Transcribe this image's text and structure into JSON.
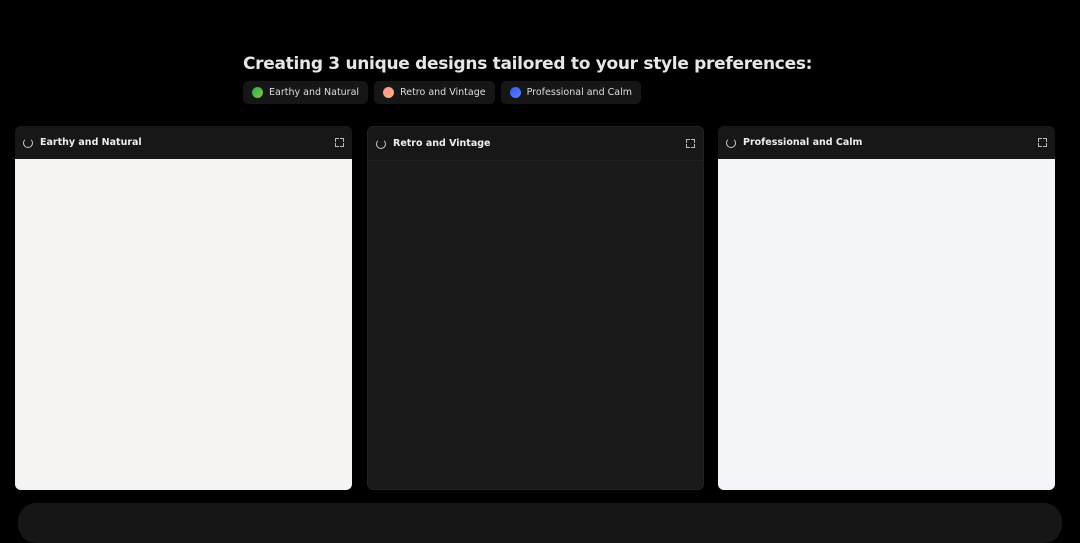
{
  "heading": "Creating 3 unique designs tailored to your style preferences:",
  "chips": [
    {
      "label": "Earthy and Natural",
      "gradient": [
        "#1fae4b",
        "#8bc34a"
      ]
    },
    {
      "label": "Retro and Vintage",
      "gradient": [
        "#ff8fa3",
        "#ffb36b"
      ]
    },
    {
      "label": "Professional and Calm",
      "gradient": [
        "#3a5bf0",
        "#5b7cff"
      ]
    }
  ],
  "cards": [
    {
      "title": "Earthy and Natural",
      "body_color": "#f5f4f2",
      "icon": "loading-spinner-icon"
    },
    {
      "title": "Retro and Vintage",
      "body_color": "#1a1a1a",
      "icon": "loading-spinner-icon"
    },
    {
      "title": "Professional and Calm",
      "body_color": "#f4f5f9",
      "icon": "loading-spinner-icon"
    }
  ]
}
